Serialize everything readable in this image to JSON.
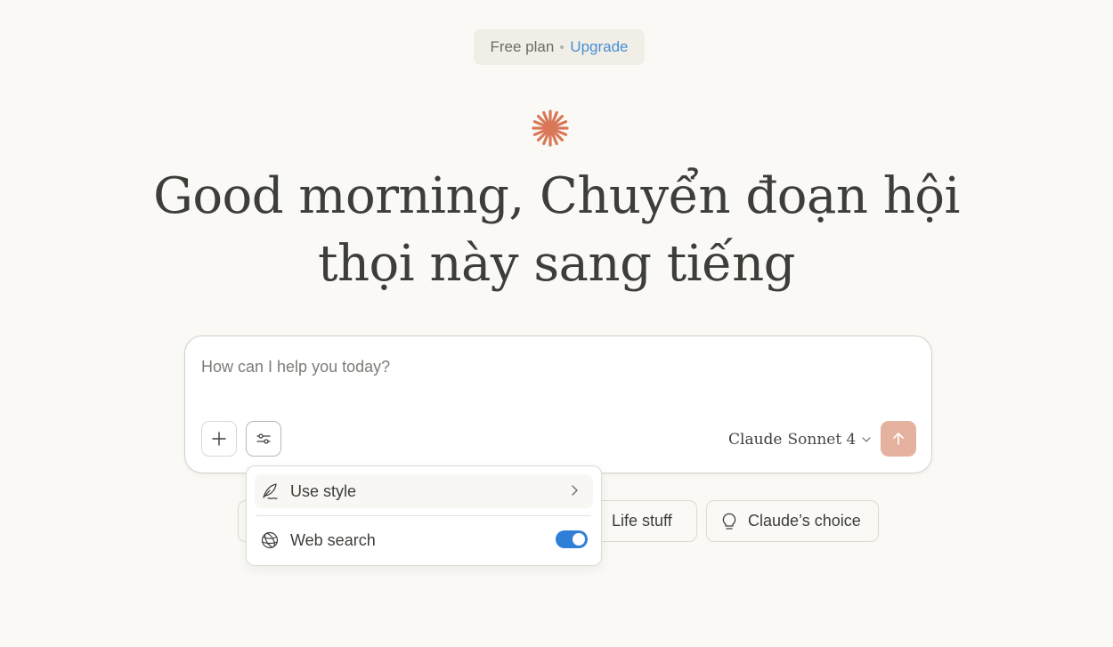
{
  "header": {
    "plan_label": "Free plan",
    "upgrade_label": "Upgrade"
  },
  "brand": {
    "logo_icon": "claude-spark-icon",
    "accent_color": "#d97757"
  },
  "greeting": {
    "text": "Good morning, Chuyển đoạn hội thọi này sang tiếng"
  },
  "composer": {
    "placeholder": "How can I help you today?",
    "value": "",
    "add_icon": "plus-icon",
    "tools_icon": "sliders-icon",
    "model_family": "Claude",
    "model_name": "Sonnet 4",
    "send_icon": "arrow-up-icon",
    "send_color": "#e5b2a0"
  },
  "menu": {
    "items": [
      {
        "label": "Use style",
        "icon": "feather-pen-icon",
        "has_submenu": true
      },
      {
        "label": "Web search",
        "icon": "globe-icon",
        "toggle_on": true
      }
    ]
  },
  "suggestions": [
    {
      "label": "Life stuff",
      "icon": "coffee-icon"
    },
    {
      "label": "Claude’s choice",
      "icon": "lightbulb-icon"
    }
  ]
}
